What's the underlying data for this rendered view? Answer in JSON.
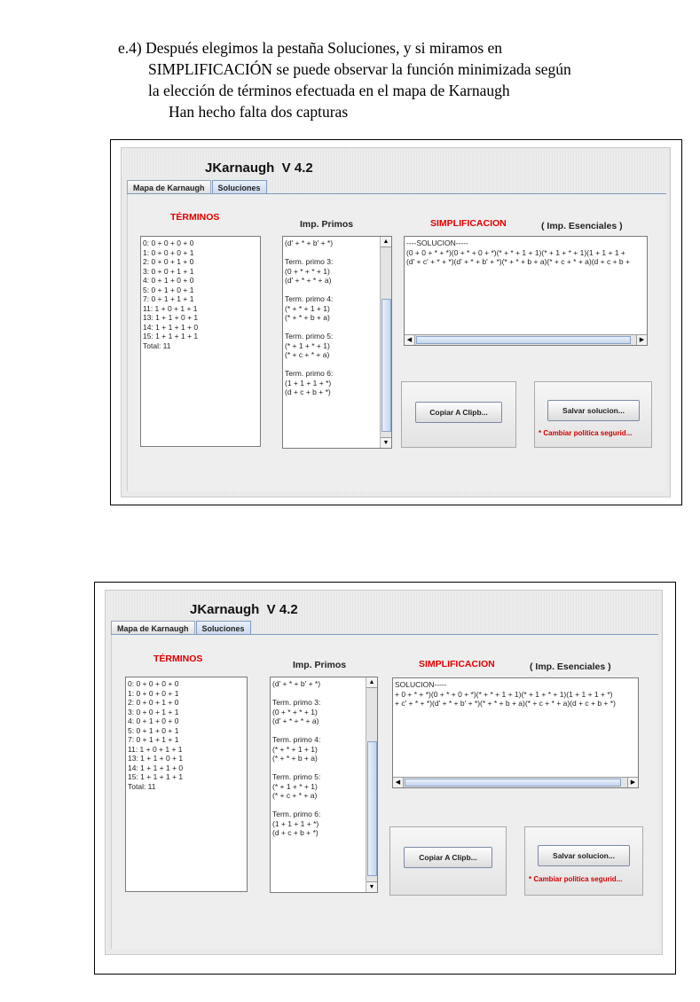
{
  "doc": {
    "lines": [
      "e.4) Después elegimos la pestaña Soluciones, y si miramos en",
      "SIMPLIFICACIÓN se puede observar la función minimizada según",
      "la elección de términos efectuada en el mapa de Karnaugh",
      "Han hecho falta dos capturas"
    ]
  },
  "app": {
    "title": "JKarnaugh  V 4.2",
    "tabs": [
      "Mapa de Karnaugh",
      "Soluciones"
    ],
    "active_tab": "Soluciones",
    "terminos_label": "TÉRMINOS",
    "primos_label": "Imp. Primos",
    "simplificacion_label": "SIMPLIFICACION",
    "esenciales_label": "( Imp. Esenciales )",
    "copy_button": "Copiar A Clipb...",
    "save_button": "Salvar solucion...",
    "policy_warning": "* Cambiar politica segurid..."
  },
  "terminos": [
    "0: 0 + 0 + 0 + 0",
    "1: 0 + 0 + 0 + 1",
    "2: 0 + 0 + 1 + 0",
    "3: 0 + 0 + 1 + 1",
    "4: 0 + 1 + 0 + 0",
    "5: 0 + 1 + 0 + 1",
    "7: 0 + 1 + 1 + 1",
    "11: 1 + 0 + 1 + 1",
    "13: 1 + 1 + 0 + 1",
    "14: 1 + 1 + 1 + 0",
    "15: 1 + 1 + 1 + 1",
    "Total: 11"
  ],
  "primos": [
    "(d' + * + b' + *)",
    "",
    "Term. primo 3:",
    "(0 + * + * + 1)",
    "(d' + * + * + a)",
    "",
    "Term. primo 4:",
    "(* + * + 1 + 1)",
    "(* + * + b + a)",
    "",
    "Term. primo 5:",
    "(* + 1 + * + 1)",
    "(* + c + * + a)",
    "",
    "Term. primo 6:",
    "(1 + 1 + 1 + *)",
    "(d + c + b + *)"
  ],
  "capture1": {
    "simplificacion": [
      "----SOLUCION-----",
      "(0 + 0 + * + *)(0 + * + 0 + *)(* + * + 1 + 1)(* + 1 + * + 1)(1 + 1 + 1 +",
      "(d' + c' + * + *)(d' + * + b' + *)(* + * + b + a)(* + c + * + a)(d + c + b +"
    ]
  },
  "capture2": {
    "simplificacion": [
      "SOLUCION-----",
      "+ 0 + * + *)(0 + * + 0 + *)(* + * + 1 + 1)(* + 1 + * + 1)(1 + 1 + 1 + *)",
      "+ c' + * + *)(d' + * + b' + *)(* + * + b + a)(* + c + * + a)(d + c + b + *)"
    ]
  }
}
